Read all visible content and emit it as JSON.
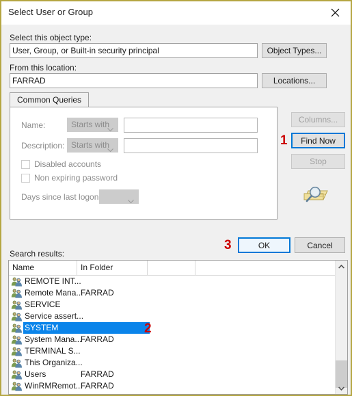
{
  "window": {
    "title": "Select User or Group",
    "close_icon": "close-icon",
    "border_color": "#b5a642"
  },
  "object_type": {
    "label": "Select this object type:",
    "value": "User, Group, or Built-in security principal",
    "button_label": "Object Types..."
  },
  "location": {
    "label": "From this location:",
    "value": "FARRAD",
    "button_label": "Locations..."
  },
  "tab": {
    "label": "Common Queries"
  },
  "query": {
    "name_label": "Name:",
    "name_operator": "Starts with",
    "name_value": "",
    "description_label": "Description:",
    "description_operator": "Starts with",
    "description_value": "",
    "disabled_accounts_label": "Disabled accounts",
    "disabled_accounts_checked": false,
    "non_expiring_password_label": "Non expiring password",
    "non_expiring_password_checked": false,
    "days_since_logon_label": "Days since last logon:",
    "days_since_logon_value": ""
  },
  "side_buttons": {
    "columns_label": "Columns...",
    "find_now_label": "Find Now",
    "stop_label": "Stop",
    "search_icon": "magnifier-folder-icon"
  },
  "footer": {
    "ok_label": "OK",
    "cancel_label": "Cancel"
  },
  "results": {
    "label": "Search results:",
    "columns": [
      "Name",
      "In Folder",
      ""
    ],
    "selected_index": 4,
    "rows": [
      {
        "name": "REMOTE INT...",
        "folder": ""
      },
      {
        "name": "Remote Mana...",
        "folder": "FARRAD"
      },
      {
        "name": "SERVICE",
        "folder": ""
      },
      {
        "name": "Service assert...",
        "folder": ""
      },
      {
        "name": "SYSTEM",
        "folder": ""
      },
      {
        "name": "System Mana...",
        "folder": "FARRAD"
      },
      {
        "name": "TERMINAL S...",
        "folder": ""
      },
      {
        "name": "This Organiza...",
        "folder": ""
      },
      {
        "name": "Users",
        "folder": "FARRAD"
      },
      {
        "name": "WinRMRemot...",
        "folder": "FARRAD"
      }
    ]
  },
  "annotations": {
    "step1": "1",
    "step2": "2",
    "step3": "3"
  },
  "colors": {
    "selection_blue": "#0a84ea",
    "focus_blue": "#0078d7",
    "annotation_red": "#cc0000"
  }
}
